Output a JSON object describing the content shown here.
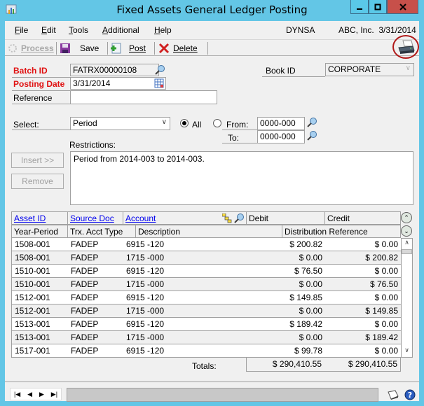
{
  "window": {
    "title": "Fixed Assets General Ledger Posting"
  },
  "menu": {
    "items": [
      {
        "label": "File",
        "key": "F",
        "rest": "ile"
      },
      {
        "label": "Edit",
        "key": "E",
        "rest": "dit"
      },
      {
        "label": "Tools",
        "key": "T",
        "rest": "ools"
      },
      {
        "label": "Additional",
        "key": "A",
        "rest": "dditional"
      },
      {
        "label": "Help",
        "key": "H",
        "rest": "elp"
      }
    ],
    "company_db": "DYNSA",
    "company_date": "ABC, Inc.  3/31/2014"
  },
  "toolbar": {
    "process_label": "Process",
    "save_label": "Save",
    "post_label": "Post",
    "delete_label": "Delete"
  },
  "form": {
    "batch_id_label": "Batch ID",
    "batch_id_value": "FATRX00000108",
    "posting_date_label": "Posting Date",
    "posting_date_value": "3/31/2014",
    "reference_label": "Reference",
    "reference_value": "",
    "book_id_label": "Book ID",
    "book_id_value": "CORPORATE",
    "select_label": "Select:",
    "select_value": "Period",
    "radio_all_label": "All",
    "radio_from_label": "From:",
    "to_label": "To:",
    "from_value": "0000-000",
    "to_value": "0000-000",
    "selected_radio": "All",
    "restrictions_label": "Restrictions:",
    "restrictions_text": "Period from 2014-003 to 2014-003.",
    "insert_label": "Insert >>",
    "remove_label": "Remove"
  },
  "grid": {
    "headers_row1": [
      "Asset ID",
      "Source Doc",
      "Account",
      "Debit",
      "Credit"
    ],
    "headers_row2": [
      "Year-Period",
      "Trx. Acct Type",
      "Description",
      "Distribution Reference"
    ],
    "rows": [
      {
        "year_period": "1508-001",
        "type": "FADEP",
        "account": "6915 -120",
        "debit": "$ 200.82",
        "credit": "$ 0.00"
      },
      {
        "year_period": "1508-001",
        "type": "FADEP",
        "account": "1715 -000",
        "debit": "$ 0.00",
        "credit": "$ 200.82"
      },
      {
        "year_period": "1510-001",
        "type": "FADEP",
        "account": "6915 -120",
        "debit": "$ 76.50",
        "credit": "$ 0.00"
      },
      {
        "year_period": "1510-001",
        "type": "FADEP",
        "account": "1715 -000",
        "debit": "$ 0.00",
        "credit": "$ 76.50"
      },
      {
        "year_period": "1512-001",
        "type": "FADEP",
        "account": "6915 -120",
        "debit": "$ 149.85",
        "credit": "$ 0.00"
      },
      {
        "year_period": "1512-001",
        "type": "FADEP",
        "account": "1715 -000",
        "debit": "$ 0.00",
        "credit": "$ 149.85"
      },
      {
        "year_period": "1513-001",
        "type": "FADEP",
        "account": "6915 -120",
        "debit": "$ 189.42",
        "credit": "$ 0.00"
      },
      {
        "year_period": "1513-001",
        "type": "FADEP",
        "account": "1715 -000",
        "debit": "$ 0.00",
        "credit": "$ 189.42"
      },
      {
        "year_period": "1517-001",
        "type": "FADEP",
        "account": "6915 -120",
        "debit": "$ 99.78",
        "credit": "$ 0.00"
      }
    ],
    "totals_label": "Totals:",
    "total_debit": "$ 290,410.55",
    "total_credit": "$ 290,410.55"
  }
}
